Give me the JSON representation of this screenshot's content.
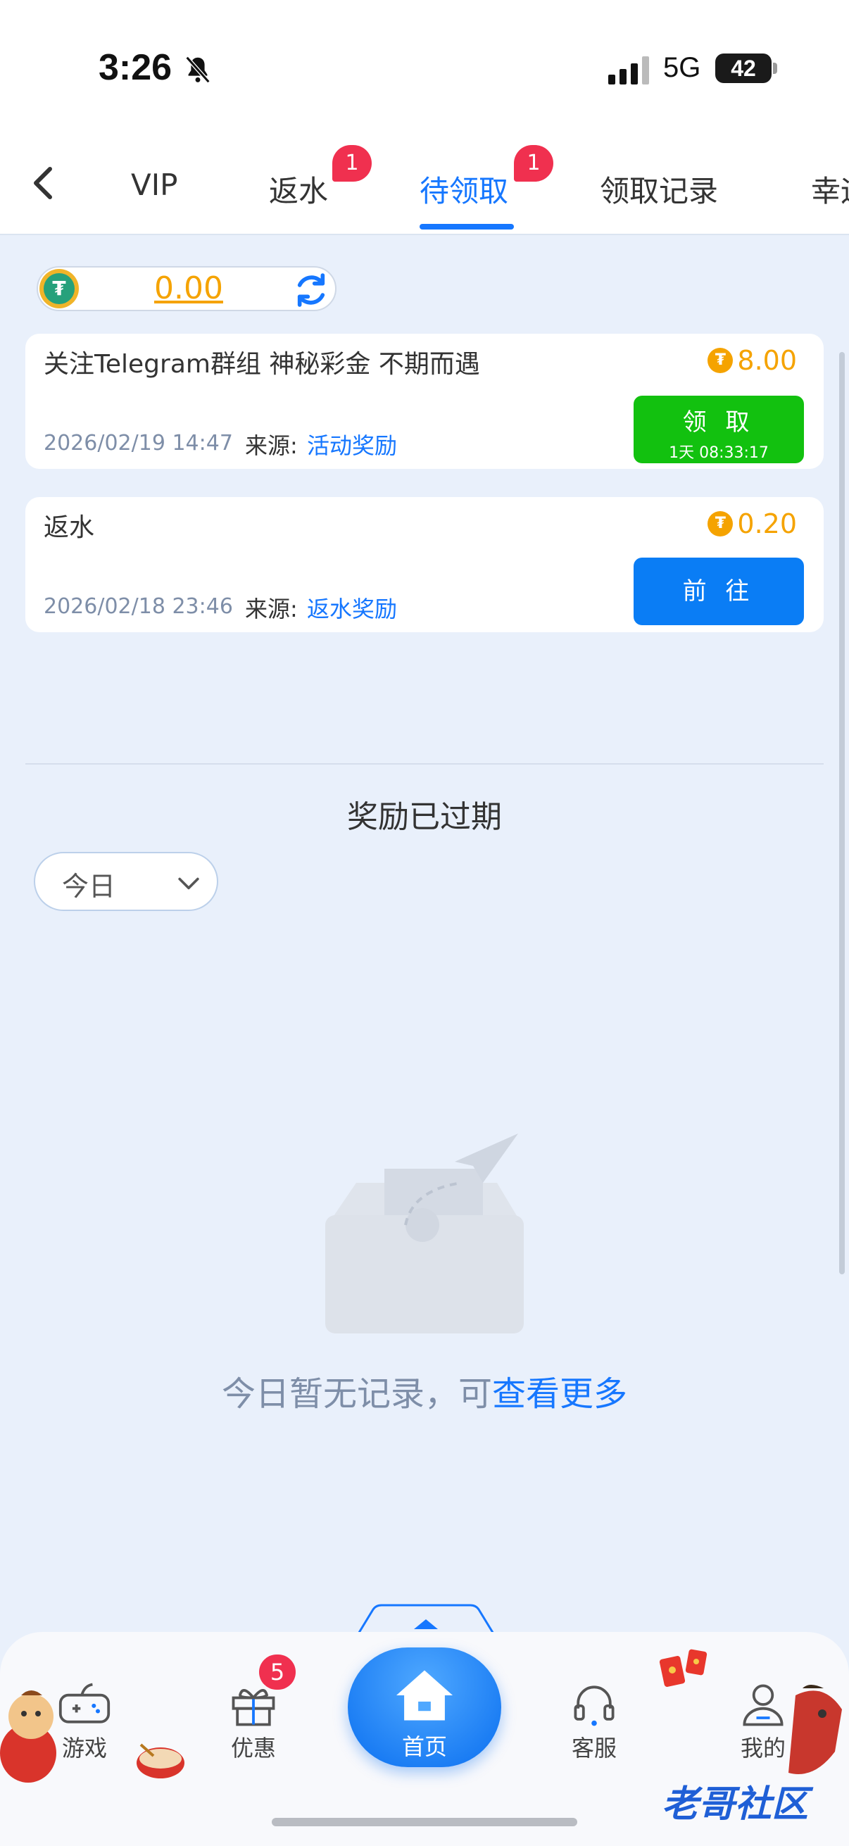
{
  "status_bar": {
    "time": "3:26",
    "network": "5G",
    "battery": "42"
  },
  "tabs": [
    {
      "label": "VIP",
      "badge": ""
    },
    {
      "label": "返水",
      "badge": "1"
    },
    {
      "label": "待领取",
      "badge": "1",
      "active": true
    },
    {
      "label": "领取记录",
      "badge": ""
    },
    {
      "label": "幸运",
      "badge": ""
    }
  ],
  "balance": {
    "amount": "0.00",
    "currency_icon": "usdt-icon"
  },
  "rewards": [
    {
      "title": "关注Telegram群组 神秘彩金 不期而遇",
      "amount": "8.00",
      "date": "2026/02/19 14:47",
      "source_label": "来源:",
      "source": "活动奖励",
      "button": "领 取",
      "countdown": "1天 08:33:17"
    },
    {
      "title": "返水",
      "amount": "0.20",
      "date": "2026/02/18 23:46",
      "source_label": "来源:",
      "source": "返水奖励",
      "button": "前 往"
    }
  ],
  "expired": {
    "title": "奖励已过期",
    "filter_value": "今日",
    "empty_text": "今日暂无记录，可",
    "empty_link": "查看更多"
  },
  "bottom_nav": {
    "games": "游戏",
    "offers": "优惠",
    "offers_badge": "5",
    "home": "首页",
    "support": "客服",
    "mine": "我的"
  },
  "watermark": "老哥社区",
  "colors": {
    "accent": "#1677ff",
    "claim_green": "#12c10f",
    "go_blue": "#0a7df5",
    "gold": "#f5a300",
    "badge_red": "#f0304f"
  }
}
